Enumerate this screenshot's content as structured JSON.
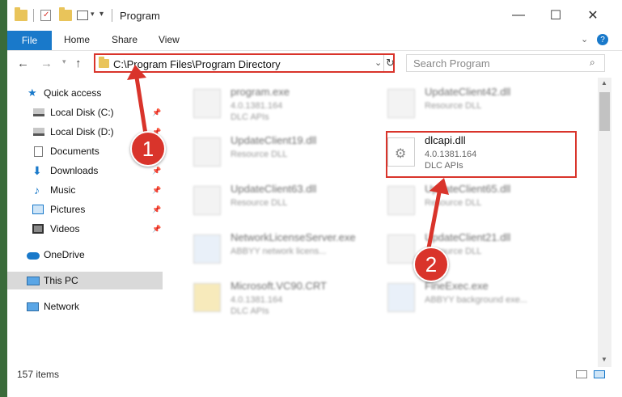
{
  "window": {
    "title": "Program",
    "controls": {
      "minimize": "—",
      "maximize": "☐",
      "close": "✕"
    }
  },
  "ribbon": {
    "file": "File",
    "tabs": [
      "Home",
      "Share",
      "View"
    ]
  },
  "address": {
    "path": "C:\\Program Files\\Program Directory",
    "search_placeholder": "Search Program"
  },
  "sidebar": {
    "items": [
      {
        "label": "Quick access",
        "icon": "star-icon",
        "pinned": false
      },
      {
        "label": "Local Disk (C:)",
        "icon": "drive-icon",
        "pinned": true
      },
      {
        "label": "Local Disk (D:)",
        "icon": "drive-icon",
        "pinned": true
      },
      {
        "label": "Documents",
        "icon": "documents-icon",
        "pinned": true
      },
      {
        "label": "Downloads",
        "icon": "downloads-icon",
        "pinned": true
      },
      {
        "label": "Music",
        "icon": "music-icon",
        "pinned": true
      },
      {
        "label": "Pictures",
        "icon": "pictures-icon",
        "pinned": true
      },
      {
        "label": "Videos",
        "icon": "videos-icon",
        "pinned": true
      },
      {
        "label": "OneDrive",
        "icon": "onedrive-icon",
        "pinned": false
      },
      {
        "label": "This PC",
        "icon": "pc-icon",
        "pinned": false,
        "selected": true
      },
      {
        "label": "Network",
        "icon": "network-icon",
        "pinned": false
      }
    ]
  },
  "files": [
    {
      "name": "program.exe",
      "line2": "4.0.1381.164",
      "line3": "DLC APIs"
    },
    {
      "name": "UpdateClient42.dll",
      "line2": "Resource DLL",
      "line3": ""
    },
    {
      "name": "UpdateClient19.dll",
      "line2": "Resource DLL",
      "line3": ""
    },
    {
      "name": "dlcapi.dll",
      "line2": "4.0.1381.164",
      "line3": "DLC APIs"
    },
    {
      "name": "UpdateClient63.dll",
      "line2": "Resource DLL",
      "line3": ""
    },
    {
      "name": "UpdateClient65.dll",
      "line2": "Resource DLL",
      "line3": ""
    },
    {
      "name": "NetworkLicenseServer.exe",
      "line2": "ABBYY network licens...",
      "line3": ""
    },
    {
      "name": "UpdateClient21.dll",
      "line2": "Resource DLL",
      "line3": ""
    },
    {
      "name": "Microsoft.VC90.CRT",
      "line2": "4.0.1381.164",
      "line3": "DLC APIs"
    },
    {
      "name": "FineExec.exe",
      "line2": "ABBYY background exe...",
      "line3": ""
    }
  ],
  "annotations": {
    "step1": "1",
    "step2": "2"
  },
  "status": {
    "count": "157 items"
  },
  "colors": {
    "accent": "#1979ca",
    "highlight": "#d9342b"
  }
}
